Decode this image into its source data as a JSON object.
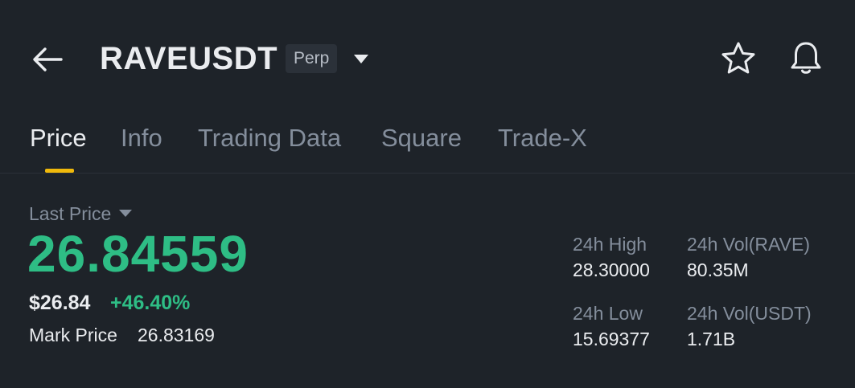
{
  "header": {
    "symbol": "RAVEUSDT",
    "badge": "Perp",
    "icons": [
      "arrow-left-icon",
      "caret-down-icon",
      "star-icon",
      "bell-icon"
    ]
  },
  "tabs": [
    {
      "label": "Price",
      "active": true
    },
    {
      "label": "Info",
      "active": false
    },
    {
      "label": "Trading Data",
      "active": false
    },
    {
      "label": "Square",
      "active": false
    },
    {
      "label": "Trade-X",
      "active": false
    }
  ],
  "price": {
    "last_price_label": "Last Price",
    "last_price": "26.84559",
    "usd_price": "$26.84",
    "change_pct": "+46.40%",
    "mark_price_label": "Mark Price",
    "mark_price": "26.83169"
  },
  "stats": {
    "high_label": "24h High",
    "high_value": "28.30000",
    "vol_base_label": "24h Vol(RAVE)",
    "vol_base_value": "80.35M",
    "low_label": "24h Low",
    "low_value": "15.69377",
    "vol_quote_label": "24h Vol(USDT)",
    "vol_quote_value": "1.71B"
  },
  "colors": {
    "background": "#1e2329",
    "up": "#2ebd85",
    "accent": "#f0b90b",
    "muted": "#848e9c",
    "text": "#eaecef"
  }
}
